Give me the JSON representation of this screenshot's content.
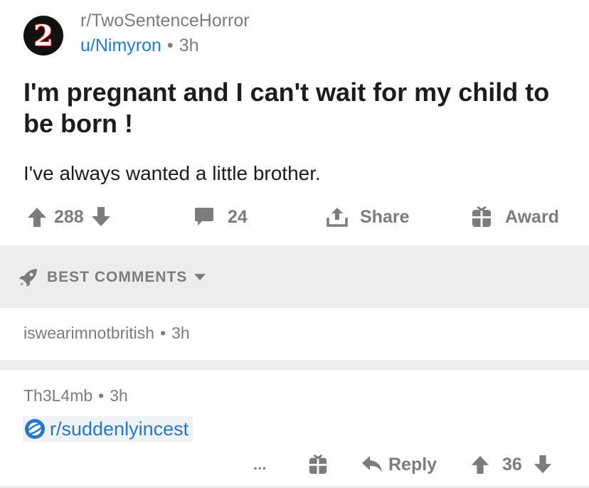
{
  "post": {
    "subreddit": "r/TwoSentenceHorror",
    "avatar_glyph": "2",
    "author": "u/Nimyron",
    "separator": "•",
    "age": "3h",
    "title": "I'm pregnant and I can't wait for my child to be born !",
    "body": "I've always wanted a little brother.",
    "votes": "288",
    "comments": "24",
    "share_label": "Share",
    "award_label": "Award"
  },
  "sort": {
    "label": "BEST COMMENTS"
  },
  "comments": [
    {
      "author": "iswearimnotbritish",
      "separator": "•",
      "age": "3h"
    },
    {
      "author": "Th3L4mb",
      "separator": "•",
      "age": "3h",
      "link_text": "r/suddenlyincest",
      "more_label": "...",
      "reply_label": "Reply",
      "votes": "36"
    }
  ],
  "colors": {
    "link_blue": "#2a78c2",
    "meta_gray": "#7c7c7c",
    "band_gray": "#ededed"
  },
  "icons": [
    "upvote-icon",
    "downvote-icon",
    "comment-icon",
    "share-icon",
    "gift-icon",
    "rocket-icon",
    "caret-down-icon",
    "subreddit-icon"
  ]
}
